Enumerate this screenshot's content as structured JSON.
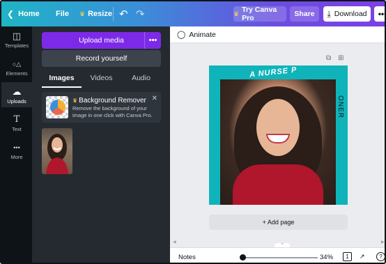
{
  "topbar": {
    "home": "Home",
    "file": "File",
    "resize": "Resize",
    "try_pro": "Try Canva Pro",
    "share": "Share",
    "download": "Download",
    "more": "•••",
    "undo_icon": "↶",
    "redo_icon": "↷",
    "crown": "♛",
    "colors": {
      "start": "#1fb4c6",
      "end": "#7d3fe6"
    }
  },
  "rail": {
    "items": [
      {
        "label": "Templates",
        "icon": "◫"
      },
      {
        "label": "Elements",
        "icon": "○△"
      },
      {
        "label": "Uploads",
        "icon": "☁"
      },
      {
        "label": "Text",
        "icon": "T"
      },
      {
        "label": "More",
        "icon": "•••"
      }
    ]
  },
  "panel": {
    "upload_media": "Upload media",
    "upload_more": "•••",
    "record": "Record yourself",
    "tabs": [
      "Images",
      "Videos",
      "Audio"
    ],
    "promo": {
      "title": "Background Remover",
      "desc": "Remove the background of your image in one click with Canva Pro.",
      "close": "✕"
    },
    "accent": "#7d2ae8"
  },
  "canvas": {
    "animate": "Animate",
    "design_top_text": "A NURSE P",
    "design_side_text": "ONER",
    "add_page": "+ Add page",
    "design_bg": "#0fb4bb"
  },
  "bottom": {
    "notes": "Notes",
    "zoom": "34%",
    "page": "1",
    "zoom_fraction": 0.0,
    "expand_icon": "↗",
    "help": "?"
  }
}
